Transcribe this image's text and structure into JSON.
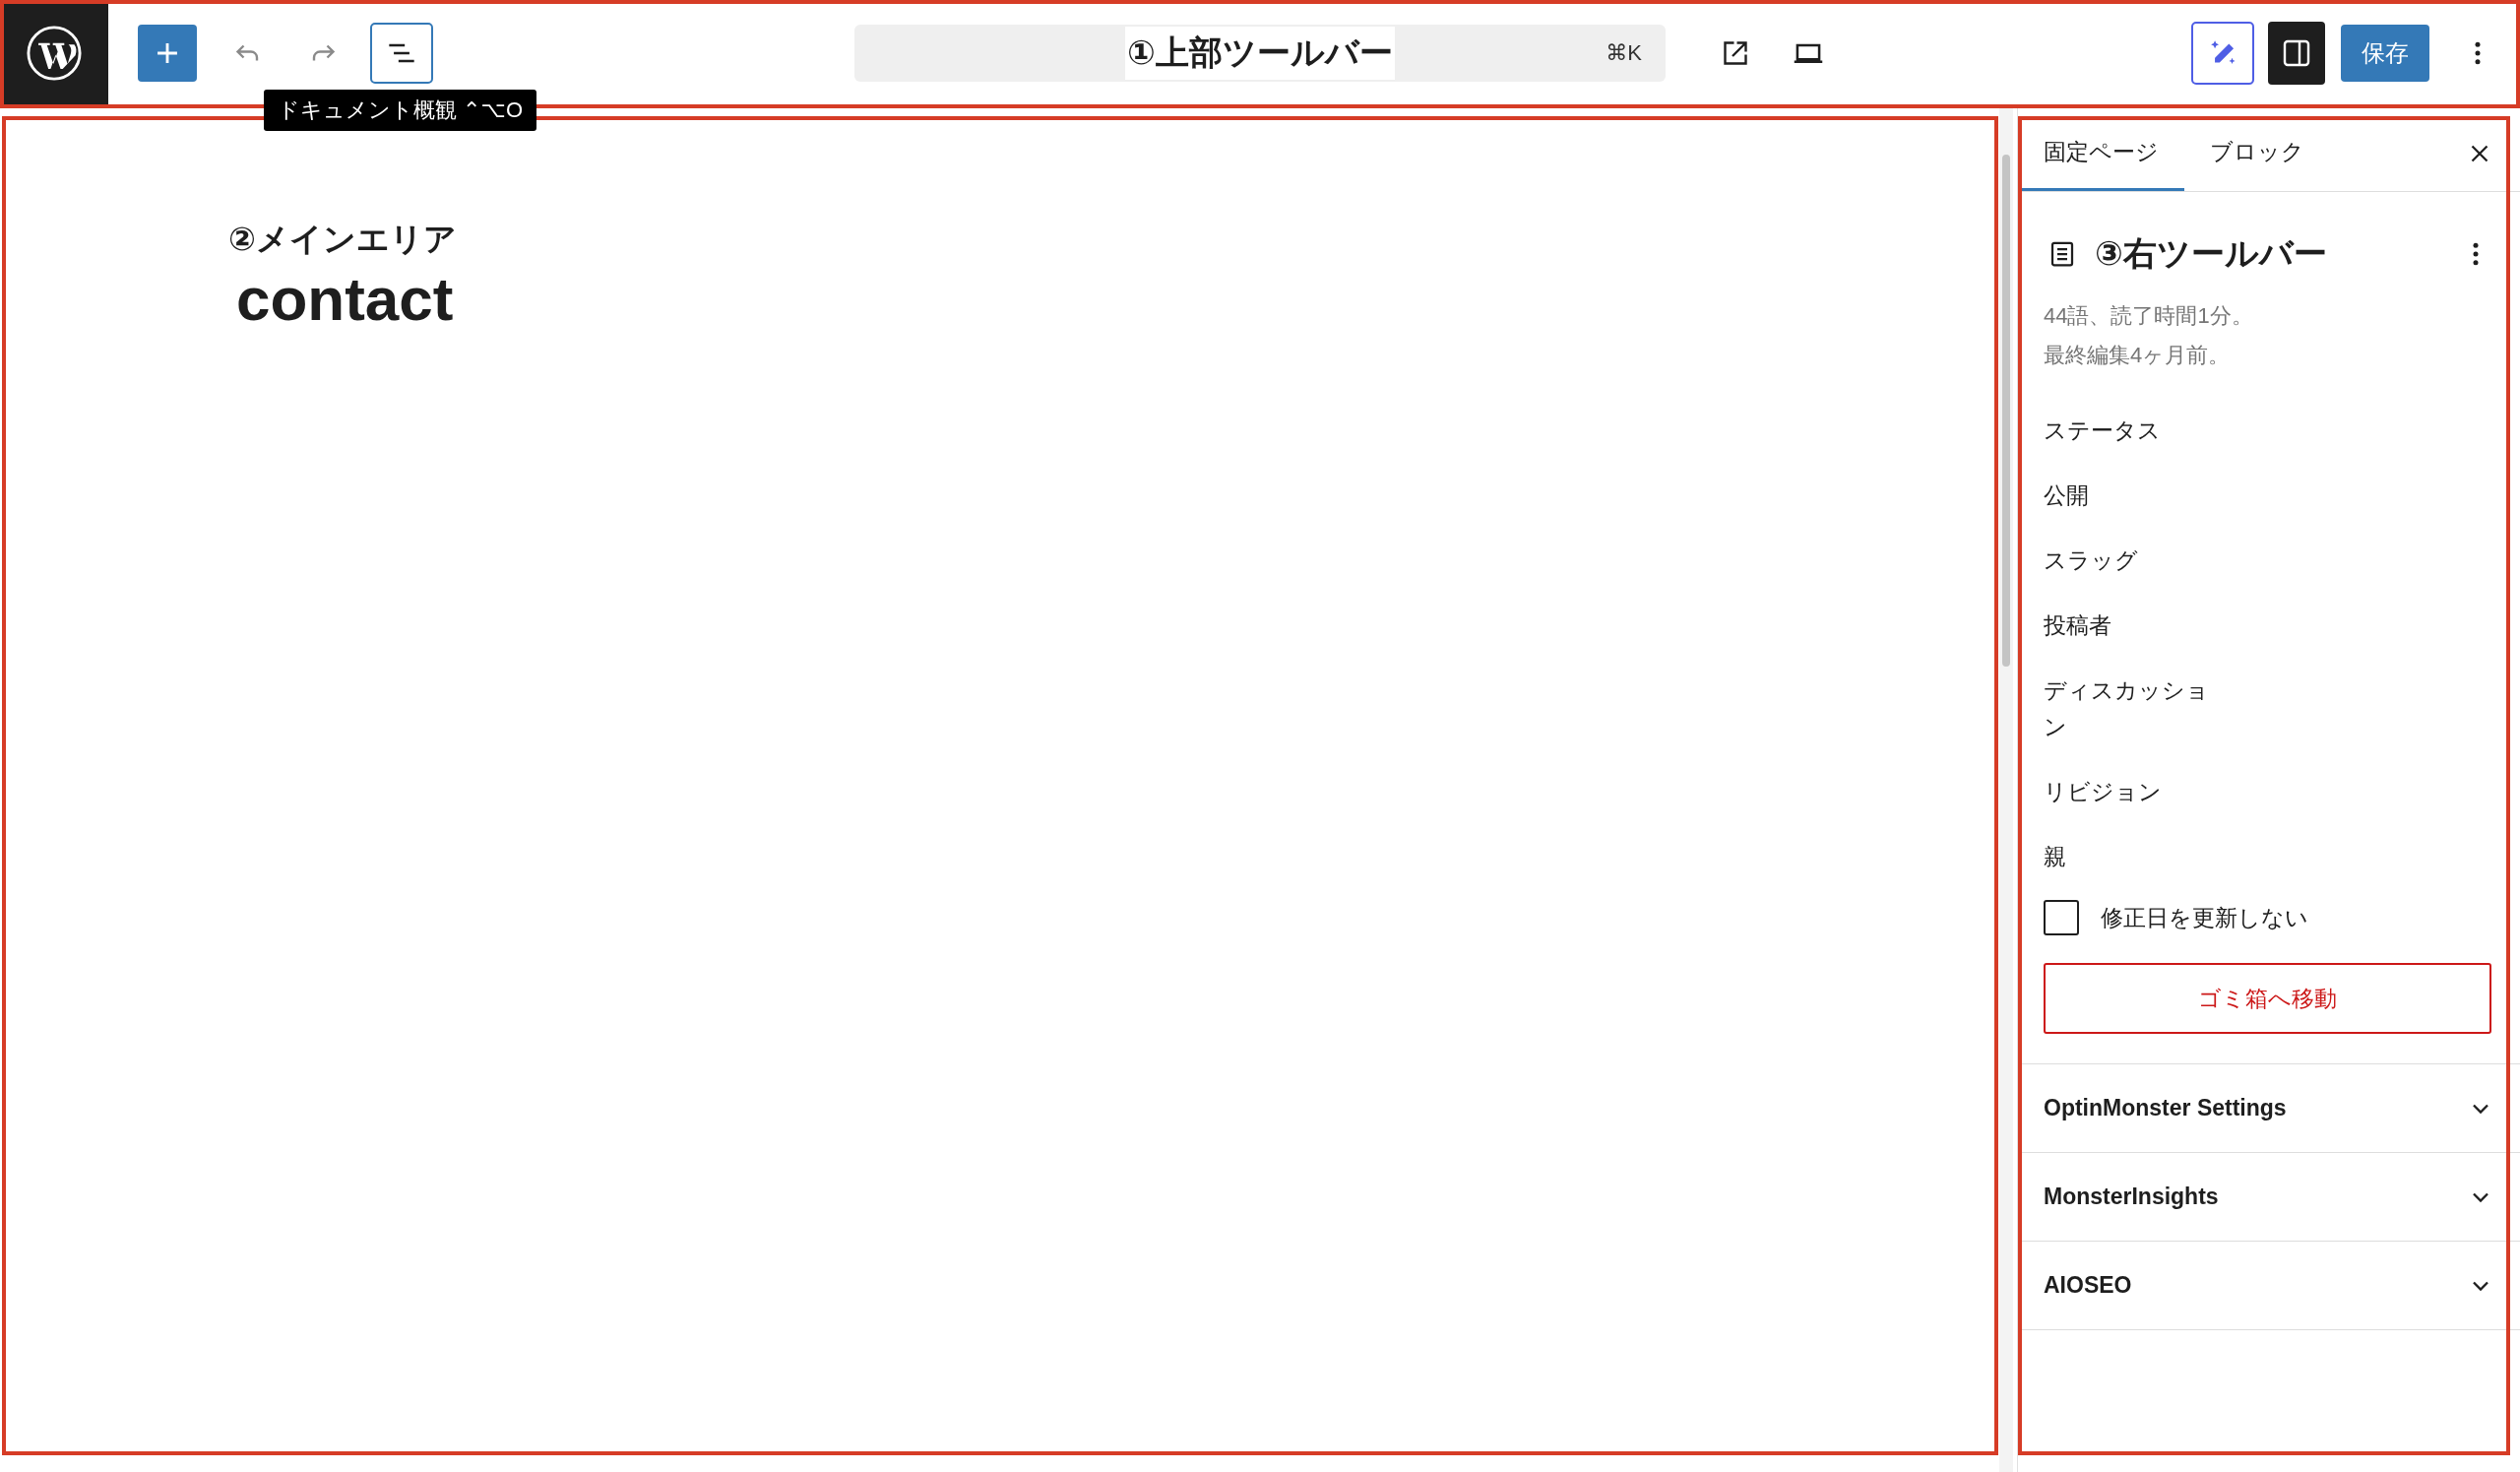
{
  "top_toolbar": {
    "annotation": "①上部ツールバー",
    "shortcut": "⌘K",
    "tooltip": "ドキュメント概観 ⌃⌥O",
    "settings_open": true,
    "save_button": "保存"
  },
  "main_area": {
    "annotation": "②メインエリア",
    "page_title": "contact"
  },
  "sidebar": {
    "tabs": [
      {
        "label": "固定ページ",
        "selected": true
      },
      {
        "label": "ブロック",
        "selected": false
      }
    ],
    "annotation": "③右ツールバー",
    "meta": [
      "44語、読了時間1分。",
      "最終編集4ヶ月前。"
    ],
    "fields": [
      "ステータス",
      "公開",
      "スラッグ",
      "投稿者",
      "ディスカッション",
      "リビジョン",
      "親"
    ],
    "checkbox": {
      "label": "修正日を更新しない",
      "checked": false
    },
    "trash_button": "ゴミ箱へ移動",
    "panels": [
      {
        "title": "OptinMonster Settings",
        "expanded": false
      },
      {
        "title": "MonsterInsights",
        "expanded": false
      },
      {
        "title": "AIOSEO",
        "expanded": false
      }
    ]
  }
}
